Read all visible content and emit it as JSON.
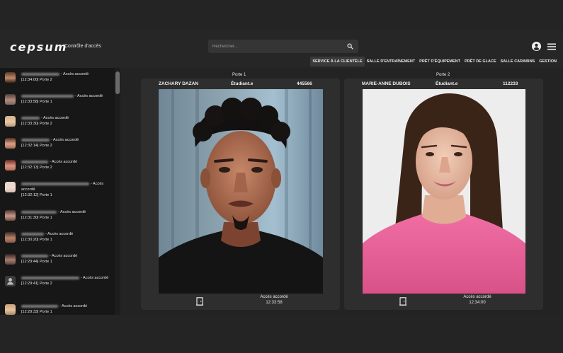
{
  "header": {
    "logo": "cepsum",
    "subtitle": "Contrôle d'accès",
    "search_placeholder": "Rechercher...",
    "nav": [
      {
        "label": "SERVICE À LA CLIENTÈLE",
        "active": true
      },
      {
        "label": "SALLE D'ENTRAÎNEMENT"
      },
      {
        "label": "PRÊT D'ÉQUIPEMENT"
      },
      {
        "label": "PRÊT DE GLACE"
      },
      {
        "label": "SALLE CARABINS"
      },
      {
        "label": "GESTION"
      }
    ]
  },
  "log": [
    {
      "status": "- Accès accordé",
      "time": "[12:34:00] Porte 2"
    },
    {
      "status": "- Accès accordé",
      "time": "[12:33:58] Porte 1"
    },
    {
      "status": "- Accès accordé",
      "time": "[12:33:30] Porte 2"
    },
    {
      "status": "- Accès accordé",
      "time": "[12:32:14] Porte 2"
    },
    {
      "status": "- Accès accordé",
      "time": "[12:32:13] Porte 2"
    },
    {
      "status": "- Accès accordé",
      "time": "[12:32:12] Porte 1"
    },
    {
      "status": "- Accès accordé",
      "time": "[12:31:30] Porte 1"
    },
    {
      "status": "- Accès accordé",
      "time": "[12:30:20] Porte 1"
    },
    {
      "status": "- Accès accordé",
      "time": "[12:29:44] Porte 1"
    },
    {
      "status": "- Accès accordé",
      "time": "[12:29:41] Porte 2"
    },
    {
      "status": "- Accès accordé",
      "time": "[12:29:33] Porte 1"
    }
  ],
  "doors": [
    {
      "label": "Porte 1",
      "name": "ZACHARY DAZAN",
      "type": "Étudiant.e",
      "id": "445566",
      "status": "Accès accordé",
      "time": "12:33:58"
    },
    {
      "label": "Porte 2",
      "name": "MARIE-ANNE DUBOIS",
      "type": "Étudiant.e",
      "id": "112233",
      "status": "Accès accordé",
      "time": "12:34:00"
    }
  ]
}
